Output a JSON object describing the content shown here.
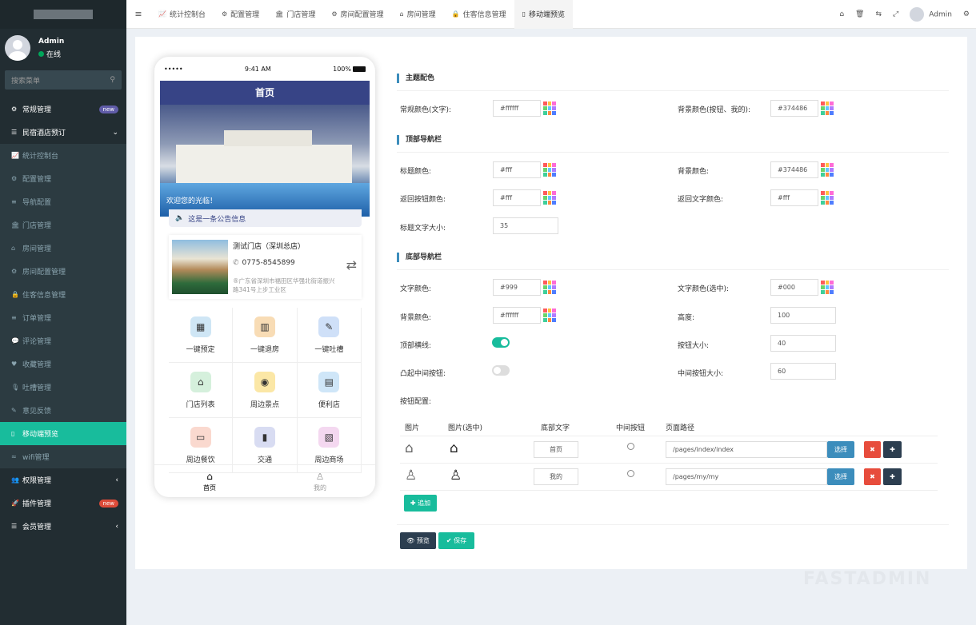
{
  "sidebar": {
    "user": {
      "name": "Admin",
      "status": "在线"
    },
    "search_placeholder": "搜索菜单",
    "items": [
      {
        "icon": "cogs-icon",
        "label": "常规管理",
        "badge": "new",
        "kind": "top"
      },
      {
        "icon": "list-icon",
        "label": "民宿酒店预订",
        "kind": "top",
        "arrow": "⌄"
      },
      {
        "icon": "chart-icon",
        "label": "统计控制台",
        "kind": "sub"
      },
      {
        "icon": "gear-icon",
        "label": "配置管理",
        "kind": "sub"
      },
      {
        "icon": "bars-icon",
        "label": "导航配置",
        "kind": "sub"
      },
      {
        "icon": "bank-icon",
        "label": "门店管理",
        "kind": "sub"
      },
      {
        "icon": "home-icon",
        "label": "房间管理",
        "kind": "sub"
      },
      {
        "icon": "gear-icon",
        "label": "房间配置管理",
        "kind": "sub"
      },
      {
        "icon": "lock-icon",
        "label": "住客信息管理",
        "kind": "sub"
      },
      {
        "icon": "bars-icon",
        "label": "订单管理",
        "kind": "sub"
      },
      {
        "icon": "comment-icon",
        "label": "评论管理",
        "kind": "sub"
      },
      {
        "icon": "heart-icon",
        "label": "收藏管理",
        "kind": "sub"
      },
      {
        "icon": "mic-icon",
        "label": "吐槽管理",
        "kind": "sub"
      },
      {
        "icon": "pencil-icon",
        "label": "意见反馈",
        "kind": "sub"
      },
      {
        "icon": "mobile-icon",
        "label": "移动端预览",
        "kind": "active"
      },
      {
        "icon": "wifi-icon",
        "label": "wifi管理",
        "kind": "sub"
      },
      {
        "icon": "users-icon",
        "label": "权限管理",
        "kind": "top",
        "arrow": "‹"
      },
      {
        "icon": "rocket-icon",
        "label": "插件管理",
        "kind": "top",
        "badge": "new",
        "badge_color": "red"
      },
      {
        "icon": "list-icon",
        "label": "会员管理",
        "kind": "top",
        "arrow": "‹"
      }
    ]
  },
  "topnav": {
    "tabs": [
      {
        "icon": "chart-icon",
        "label": "统计控制台"
      },
      {
        "icon": "gear-icon",
        "label": "配置管理"
      },
      {
        "icon": "bank-icon",
        "label": "门店管理"
      },
      {
        "icon": "gear-icon",
        "label": "房间配置管理"
      },
      {
        "icon": "home-icon",
        "label": "房间管理"
      },
      {
        "icon": "lock-icon",
        "label": "住客信息管理"
      },
      {
        "icon": "mobile-icon",
        "label": "移动端预览",
        "active": true
      }
    ],
    "user": "Admin"
  },
  "phone": {
    "status": {
      "signal": "•••••",
      "time": "9:41 AM",
      "battery": "100%"
    },
    "title": "首页",
    "welcome": "欢迎您的光临！",
    "notice": "这是一条公告信息",
    "store": {
      "name": "测试门店（深圳总店）",
      "phone": "0775-8545899",
      "address": "®广东省深圳市福田区华强北街道振兴路341号上步工业区"
    },
    "grid": [
      {
        "label": "一键预定",
        "icon": "calendar-icon",
        "color": "#cfe6f5"
      },
      {
        "label": "一键退房",
        "icon": "building-icon",
        "color": "#f8dcb5"
      },
      {
        "label": "一键吐槽",
        "icon": "note-icon",
        "color": "#cfe0f8"
      },
      {
        "label": "门店列表",
        "icon": "shop-icon",
        "color": "#d5f0dc"
      },
      {
        "label": "周边景点",
        "icon": "location-icon",
        "color": "#fbe7a6"
      },
      {
        "label": "便利店",
        "icon": "store-icon",
        "color": "#cfe6f8"
      },
      {
        "label": "周边餐饮",
        "icon": "food-icon",
        "color": "#fad9cf"
      },
      {
        "label": "交通",
        "icon": "bus-icon",
        "color": "#d8dcf2"
      },
      {
        "label": "周边商场",
        "icon": "mall-icon",
        "color": "#f4d8f0"
      }
    ],
    "tabbar": [
      {
        "label": "首页",
        "icon": "home-icon",
        "on": true
      },
      {
        "label": "我的",
        "icon": "user-icon",
        "on": false
      }
    ]
  },
  "form": {
    "theme": {
      "title": "主题配色",
      "text_color_label": "常规颜色(文字):",
      "text_color": "#ffffff",
      "bg_color_label": "背景颜色(按钮、我的):",
      "bg_color": "#374486"
    },
    "topbar": {
      "title": "顶部导航栏",
      "title_color_label": "标题颜色:",
      "title_color": "#fff",
      "bg_color_label": "背景颜色:",
      "bg_color": "#374486",
      "back_btn_color_label": "返回按钮颜色:",
      "back_btn_color": "#fff",
      "back_text_color_label": "返回文字颜色:",
      "back_text_color": "#fff",
      "title_size_label": "标题文字大小:",
      "title_size": "35"
    },
    "bottombar": {
      "title": "底部导航栏",
      "text_color_label": "文字颜色:",
      "text_color": "#999",
      "text_color_sel_label": "文字颜色(选中):",
      "text_color_sel": "#000",
      "bg_color_label": "背景颜色:",
      "bg_color": "#ffffff",
      "height_label": "高度:",
      "height": "100",
      "top_line_label": "顶部横线:",
      "top_line": true,
      "btn_size_label": "按钮大小:",
      "btn_size": "40",
      "raised_label": "凸起中间按钮:",
      "raised": false,
      "mid_size_label": "中间按钮大小:",
      "mid_size": "60",
      "buttons_label": "按钮配置:"
    },
    "table": {
      "headers": [
        "图片",
        "图片(选中)",
        "底部文字",
        "中间按钮",
        "页面路径"
      ],
      "rows": [
        {
          "icon": "home-icon",
          "text": "首页",
          "path": "/pages/index/index"
        },
        {
          "icon": "user-icon",
          "text": "我的",
          "path": "/pages/my/my"
        }
      ],
      "select_label": "选择",
      "delete_glyph": "✖",
      "move_glyph": "✚",
      "add_label": "✚ 追加"
    },
    "preview_label": "👁 预览",
    "save_label": "✔ 保存"
  },
  "watermark": "FASTADMIN"
}
